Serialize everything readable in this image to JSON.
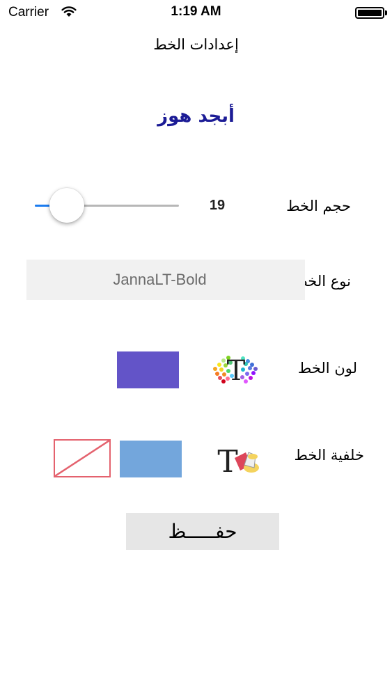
{
  "status_bar": {
    "carrier": "Carrier",
    "time": "1:19 AM"
  },
  "nav": {
    "title": "إعدادات الخط"
  },
  "preview": {
    "text": "أبجد هوز",
    "color": "#1c1c96"
  },
  "font_size": {
    "label": "حجم الخط",
    "value": "19",
    "slider_fraction": 0.22
  },
  "font_type": {
    "label": "نوع الخط",
    "value": "JannaLT-Bold"
  },
  "font_color": {
    "label": "لون الخط",
    "swatch_color": "#6354c8",
    "icon": "text-color-palette-icon"
  },
  "font_background": {
    "label": "خلفية الخط",
    "swatch_color": "#73a6dc",
    "none_color": "#e4626e",
    "icon": "text-background-paint-icon"
  },
  "save": {
    "label": "حفـــــظ"
  }
}
